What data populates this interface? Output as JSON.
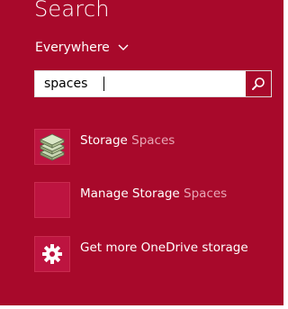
{
  "search": {
    "title": "Search",
    "scope_label": "Everywhere",
    "query": "spaces"
  },
  "results": [
    {
      "label_main": "Storage ",
      "label_dim": "Spaces",
      "icon": "storage-drives-icon"
    },
    {
      "label_main": "Manage Storage ",
      "label_dim": "Spaces",
      "icon": "blank-tile-icon"
    },
    {
      "label_main": "Get more OneDrive storage",
      "label_dim": "",
      "icon": "gear-icon"
    }
  ],
  "colors": {
    "panel_bg": "#a8092b",
    "tile_bg": "#bd1440",
    "dim_text": "#e7a6b6",
    "text": "#ffffff"
  }
}
